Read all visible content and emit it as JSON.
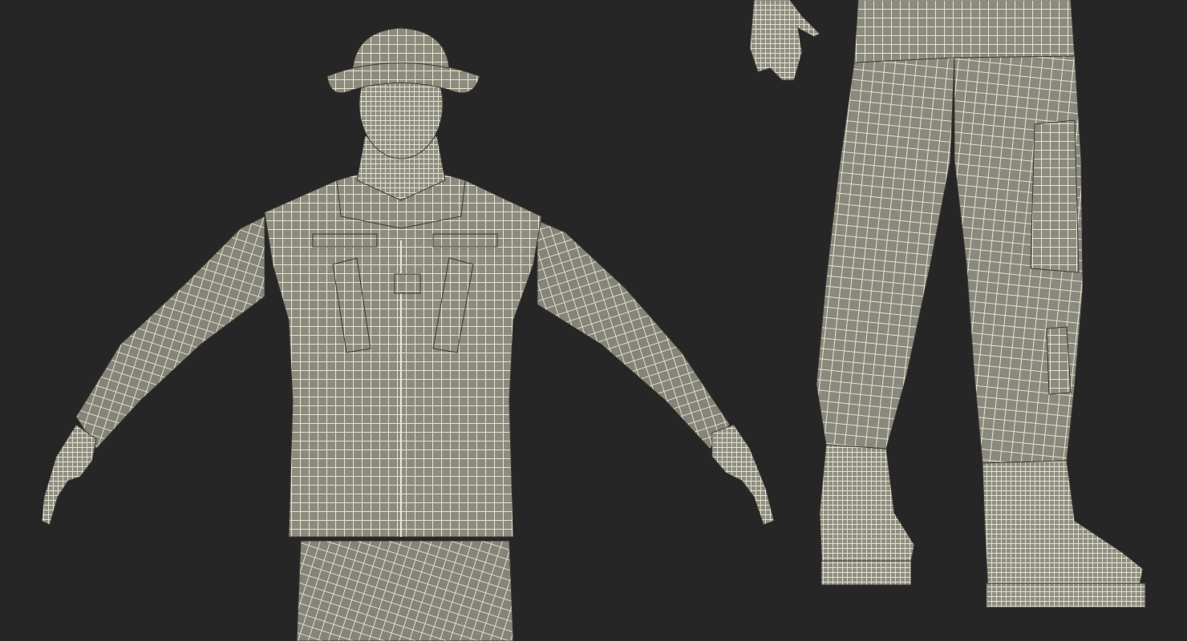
{
  "scene": {
    "background": "#262626",
    "mesh_fill": "#8c8b7e",
    "mesh_fill_dark": "#75746a",
    "wire_color": "#f4f0dc",
    "views": [
      "front-upper-body",
      "back-lower-legs"
    ]
  }
}
